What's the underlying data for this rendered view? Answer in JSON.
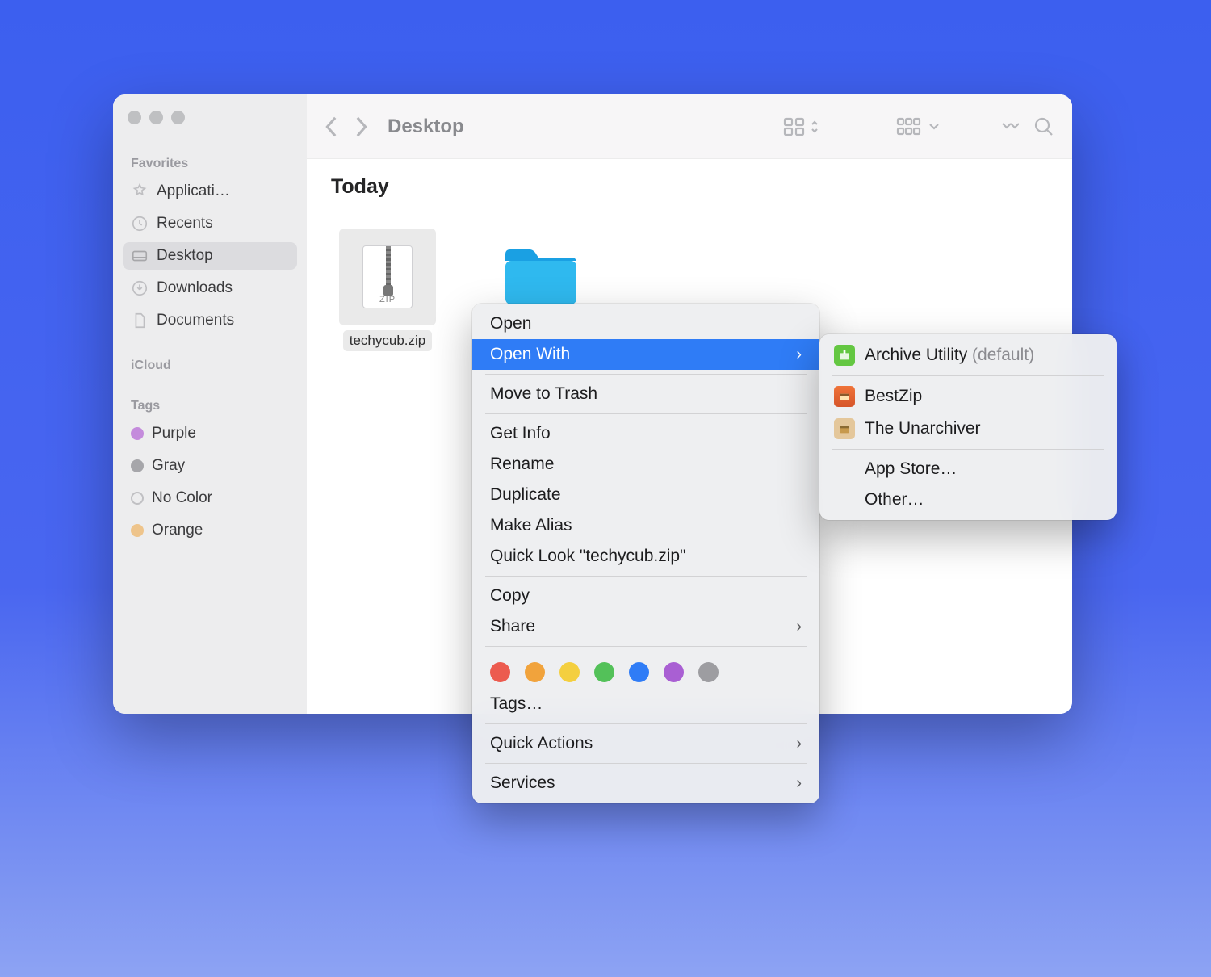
{
  "toolbar": {
    "title": "Desktop"
  },
  "sidebar": {
    "favorites_title": "Favorites",
    "icloud_title": "iCloud",
    "tags_title": "Tags",
    "items": [
      {
        "label": "Applicati…"
      },
      {
        "label": "Recents"
      },
      {
        "label": "Desktop"
      },
      {
        "label": "Downloads"
      },
      {
        "label": "Documents"
      }
    ],
    "tags": [
      {
        "label": "Purple"
      },
      {
        "label": "Gray"
      },
      {
        "label": "No Color"
      },
      {
        "label": "Orange"
      }
    ]
  },
  "content": {
    "group_header": "Today",
    "files": [
      {
        "name": "techycub.zip",
        "zip_badge": "ZIP"
      },
      {
        "name": ""
      }
    ]
  },
  "context_menu": {
    "open": "Open",
    "open_with": "Open With",
    "move_to_trash": "Move to Trash",
    "get_info": "Get Info",
    "rename": "Rename",
    "duplicate": "Duplicate",
    "make_alias": "Make Alias",
    "quick_look": "Quick Look \"techycub.zip\"",
    "copy": "Copy",
    "share": "Share",
    "tags": "Tags…",
    "quick_actions": "Quick Actions",
    "services": "Services"
  },
  "submenu": {
    "archive_utility": "Archive Utility",
    "default_suffix": "(default)",
    "bestzip": "BestZip",
    "unarchiver": "The Unarchiver",
    "app_store": "App Store…",
    "other": "Other…"
  }
}
